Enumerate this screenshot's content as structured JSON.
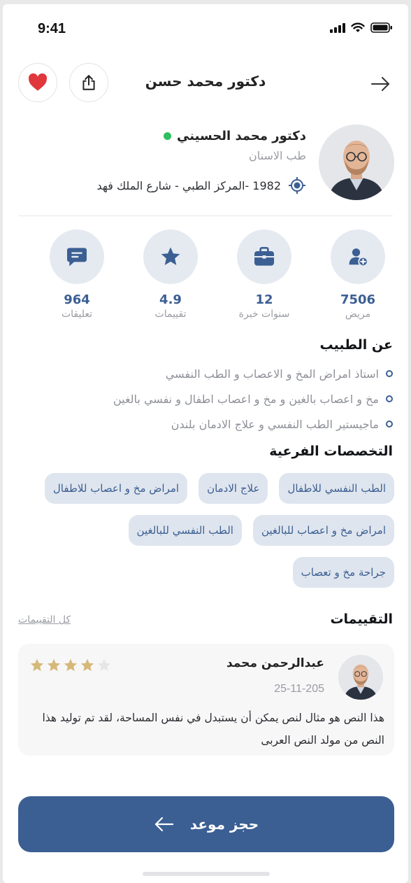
{
  "status_bar": {
    "time": "9:41"
  },
  "header": {
    "title": "دكتور محمد حسن"
  },
  "doctor": {
    "name": "دكتور محمد الحسيني",
    "specialty": "طب الاسنان",
    "address": "1982 -المركز الطبي - شارع الملك فهد"
  },
  "stats": [
    {
      "value": "7506",
      "label": "مريض",
      "icon": "add-patient-icon"
    },
    {
      "value": "12",
      "label": "سنوات خبرة",
      "icon": "briefcase-icon"
    },
    {
      "value": "4.9",
      "label": "تقييمات",
      "icon": "star-icon"
    },
    {
      "value": "964",
      "label": "تعليقات",
      "icon": "chat-icon"
    }
  ],
  "about": {
    "title": "عن الطبيب",
    "items": [
      "استاذ امراض المخ و الاعصاب و الطب النفسي",
      "مخ و اعصاب بالغين و مخ و اعصاب اطفال و نفسي بالغين",
      "ماجيستير الطب النفسي و علاج الادمان بلندن"
    ]
  },
  "subspecialties": {
    "title": "التخصصات الفرعية",
    "items": [
      "الطب النفسي للاطفال",
      "علاج الادمان",
      "امراض مخ و اعصاب للاطفال",
      "امراض مخ و اعصاب للبالغين",
      "الطب النفسي للبالغين",
      "جراحة مخ و تعصاب"
    ]
  },
  "reviews": {
    "title": "التقييمات",
    "all_link": "كل التقييمات",
    "items": [
      {
        "name": "عبدالرحمن محمد",
        "date": "25-11-205",
        "rating": 4,
        "max_rating": 5,
        "text": "هذا النص هو مثال لنص يمكن أن يستبدل في نفس المساحة، لقد تم توليد هذا النص من مولد النص العربى"
      }
    ]
  },
  "cta": {
    "label": "حجز موعد"
  },
  "colors": {
    "primary": "#3b5f93",
    "chip_bg": "#dfe5ee",
    "star": "#d6b878",
    "online": "#2fbf5e",
    "heart": "#e0373d"
  }
}
